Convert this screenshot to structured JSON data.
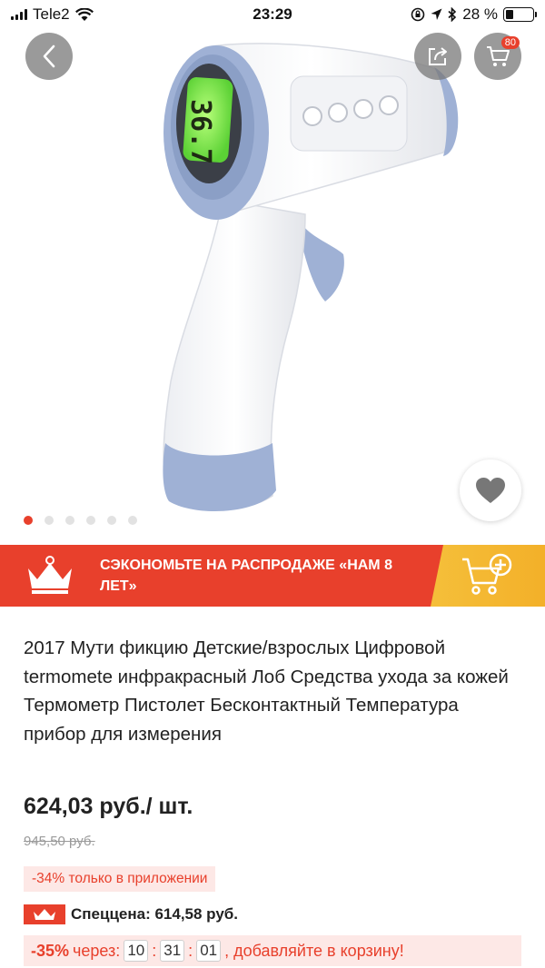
{
  "status_bar": {
    "carrier": "Tele2",
    "time": "23:29",
    "battery": "28 %",
    "battery_level": 0.28
  },
  "gallery": {
    "cart_count": "80",
    "image_count": 6,
    "active_index": 0,
    "display_temperature": "36.7"
  },
  "banner": {
    "text": "Сэкономьте на распродаже «НАМ 8 ЛЕТ»"
  },
  "product": {
    "title": "2017 Мути фикцию Детские/взрослых Цифровой termomete инфракрасный Лоб Средства ухода за кожей Термометр Пистолет Бесконтактный Температура прибор для измерения",
    "price": "624,03 руб./ шт.",
    "old_price": "945,50 руб.",
    "app_discount": "-34% только в приложении",
    "special_price": "Спеццена: 614,58 руб."
  },
  "timer": {
    "percent": "-35%",
    "label": "через:",
    "hours": "10",
    "minutes": "31",
    "seconds": "01",
    "suffix": ", добавляйте в корзину!"
  },
  "colors": {
    "accent": "#e8402c",
    "gold": "#f5bf3a",
    "device_blue": "#8fa6cf",
    "screen_green": "#7df05a"
  }
}
